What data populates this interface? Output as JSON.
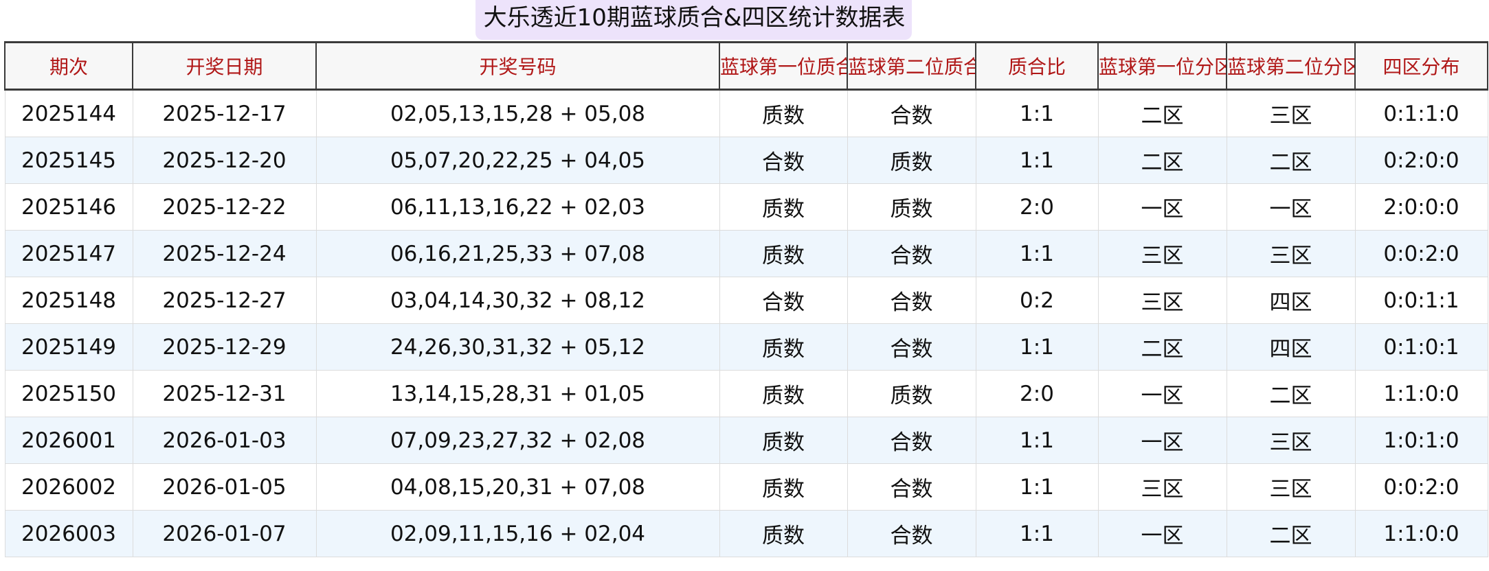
{
  "title": "大乐透近10期蓝球质合&四区统计数据表",
  "table": {
    "headers": [
      "期次",
      "开奖日期",
      "开奖号码",
      "蓝球第一位质合",
      "蓝球第二位质合",
      "质合比",
      "蓝球第一位分区",
      "蓝球第二位分区",
      "四区分布"
    ],
    "rows": [
      [
        "2025144",
        "2025-12-17",
        "02,05,13,15,28 + 05,08",
        "质数",
        "合数",
        "1:1",
        "二区",
        "三区",
        "0:1:1:0"
      ],
      [
        "2025145",
        "2025-12-20",
        "05,07,20,22,25 + 04,05",
        "合数",
        "质数",
        "1:1",
        "二区",
        "二区",
        "0:2:0:0"
      ],
      [
        "2025146",
        "2025-12-22",
        "06,11,13,16,22 + 02,03",
        "质数",
        "质数",
        "2:0",
        "一区",
        "一区",
        "2:0:0:0"
      ],
      [
        "2025147",
        "2025-12-24",
        "06,16,21,25,33 + 07,08",
        "质数",
        "合数",
        "1:1",
        "三区",
        "三区",
        "0:0:2:0"
      ],
      [
        "2025148",
        "2025-12-27",
        "03,04,14,30,32 + 08,12",
        "合数",
        "合数",
        "0:2",
        "三区",
        "四区",
        "0:0:1:1"
      ],
      [
        "2025149",
        "2025-12-29",
        "24,26,30,31,32 + 05,12",
        "质数",
        "合数",
        "1:1",
        "二区",
        "四区",
        "0:1:0:1"
      ],
      [
        "2025150",
        "2025-12-31",
        "13,14,15,28,31 + 01,05",
        "质数",
        "质数",
        "2:0",
        "一区",
        "二区",
        "1:1:0:0"
      ],
      [
        "2026001",
        "2026-01-03",
        "07,09,23,27,32 + 02,08",
        "质数",
        "合数",
        "1:1",
        "一区",
        "三区",
        "1:0:1:0"
      ],
      [
        "2026002",
        "2026-01-05",
        "04,08,15,20,31 + 07,08",
        "质数",
        "合数",
        "1:1",
        "三区",
        "三区",
        "0:0:2:0"
      ],
      [
        "2026003",
        "2026-01-07",
        "02,09,11,15,16 + 02,04",
        "质数",
        "合数",
        "1:1",
        "一区",
        "二区",
        "1:1:0:0"
      ]
    ]
  }
}
